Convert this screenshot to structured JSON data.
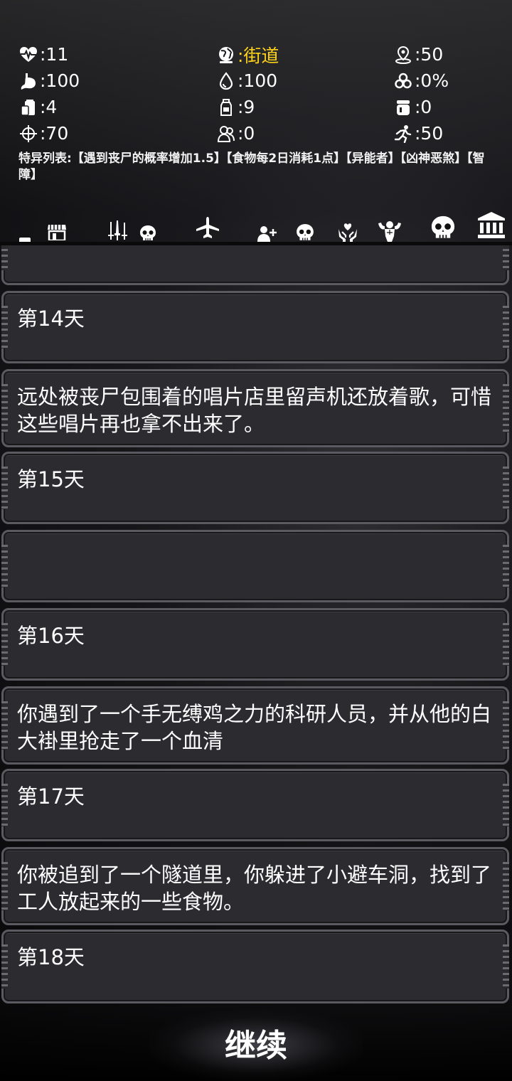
{
  "stats": {
    "health": {
      "icon": "heartbeat-icon",
      "value": ":11"
    },
    "location": {
      "icon": "globe-icon",
      "value": ":街道"
    },
    "distance": {
      "icon": "map-pin-icon",
      "value": ":50"
    },
    "stomach": {
      "icon": "stomach-icon",
      "value": ":100"
    },
    "water": {
      "icon": "water-drop-icon",
      "value": ":100"
    },
    "infection": {
      "icon": "biohazard-icon",
      "value": ":0%"
    },
    "food": {
      "icon": "food-can-icon",
      "value": ":4"
    },
    "bottle": {
      "icon": "bottle-icon",
      "value": ":9"
    },
    "jar": {
      "icon": "jar-icon",
      "value": ":0"
    },
    "accuracy": {
      "icon": "crosshair-icon",
      "value": ":70"
    },
    "companions": {
      "icon": "people-icon",
      "value": ":0"
    },
    "speed": {
      "icon": "running-icon",
      "value": ":50"
    }
  },
  "traits": "特异列表:【遇到丧尸的概率增加1.5】【食物每2日消耗1点】【异能者】【凶神恶煞】【智障】",
  "toolbar": [
    {
      "icon": "small-square-icon"
    },
    {
      "icon": "shop-icon"
    },
    {
      "icon": "weapons-icon"
    },
    {
      "icon": "skull-icon"
    },
    {
      "icon": "airplane-icon"
    },
    {
      "icon": "add-person-icon"
    },
    {
      "icon": "skull-icon"
    },
    {
      "icon": "caring-hands-icon"
    },
    {
      "icon": "muscle-icon"
    },
    {
      "icon": "skull-icon"
    },
    {
      "icon": "bank-icon"
    }
  ],
  "log": [
    {
      "text": ""
    },
    {
      "text": "第14天"
    },
    {
      "text": "远处被丧尸包围着的唱片店里留声机还放着歌，可惜这些唱片再也拿不出来了。"
    },
    {
      "text": "第15天"
    },
    {
      "text": ""
    },
    {
      "text": "第16天"
    },
    {
      "text": "你遇到了一个手无缚鸡之力的科研人员，并从他的白大褂里抢走了一个血清"
    },
    {
      "text": "第17天"
    },
    {
      "text": "你被追到了一个隧道里，你躲进了小避车洞，找到了工人放起来的一些食物。"
    },
    {
      "text": "第18天"
    }
  ],
  "continue_label": "继续",
  "colors": {
    "location": "#ffd21a",
    "card_bg": "#2b2b30",
    "card_border": "#5a5a60"
  }
}
